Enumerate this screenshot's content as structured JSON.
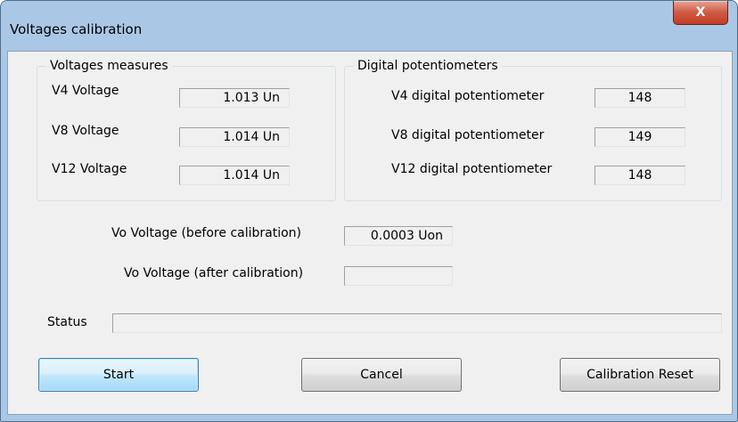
{
  "window": {
    "title": "Voltages calibration",
    "close_glyph": "X"
  },
  "voltages": {
    "legend": "Voltages measures",
    "rows": [
      {
        "label": "V4 Voltage",
        "value": "1.013 Un"
      },
      {
        "label": "V8 Voltage",
        "value": "1.014 Un"
      },
      {
        "label": "V12 Voltage",
        "value": "1.014 Un"
      }
    ]
  },
  "potentiometers": {
    "legend": "Digital potentiometers",
    "rows": [
      {
        "label": "V4 digital potentiometer",
        "value": "148"
      },
      {
        "label": "V8 digital potentiometer",
        "value": "149"
      },
      {
        "label": "V12 digital potentiometer",
        "value": "148"
      }
    ]
  },
  "vo": {
    "before_label": "Vo Voltage (before calibration)",
    "before_value": "0.0003 Uon",
    "after_label": "Vo Voltage (after calibration)",
    "after_value": ""
  },
  "status": {
    "label": "Status",
    "value": ""
  },
  "buttons": {
    "start": "Start",
    "cancel": "Cancel",
    "reset": "Calibration Reset"
  },
  "colors": {
    "frame": "#aac8e6",
    "client": "#f0f0f0",
    "close": "#c23c26",
    "default_button": "#bee6fd"
  }
}
